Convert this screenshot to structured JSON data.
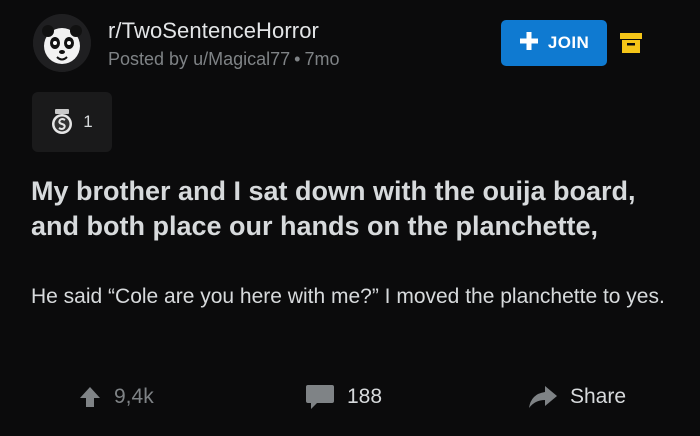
{
  "post": {
    "subreddit": "r/TwoSentenceHorror",
    "posted_prefix": "Posted by",
    "author": "u/Magical77",
    "separator": "•",
    "age": "7mo",
    "join_label": "JOIN",
    "award_count": "1",
    "title": "My brother and I sat down with the ouija board, and both place our hands on the planchette,",
    "body": "He said “Cole are you here with me?” I moved the planchette to yes."
  },
  "actions": {
    "upvotes": "9,4k",
    "comments": "188",
    "share_label": "Share"
  },
  "icons": {
    "avatar": "panda-avatar-icon",
    "join": "plus-icon",
    "archive": "archive-box-icon",
    "award": "silver-award-icon",
    "upvote": "upvote-arrow-icon",
    "comments": "comment-bubble-icon",
    "share": "share-arrow-icon"
  },
  "colors": {
    "background": "#0b0b0c",
    "join_button": "#0f7ad1",
    "archive_icon": "#f5c518",
    "text": "#d7dadc",
    "muted_text": "#7f8386"
  }
}
